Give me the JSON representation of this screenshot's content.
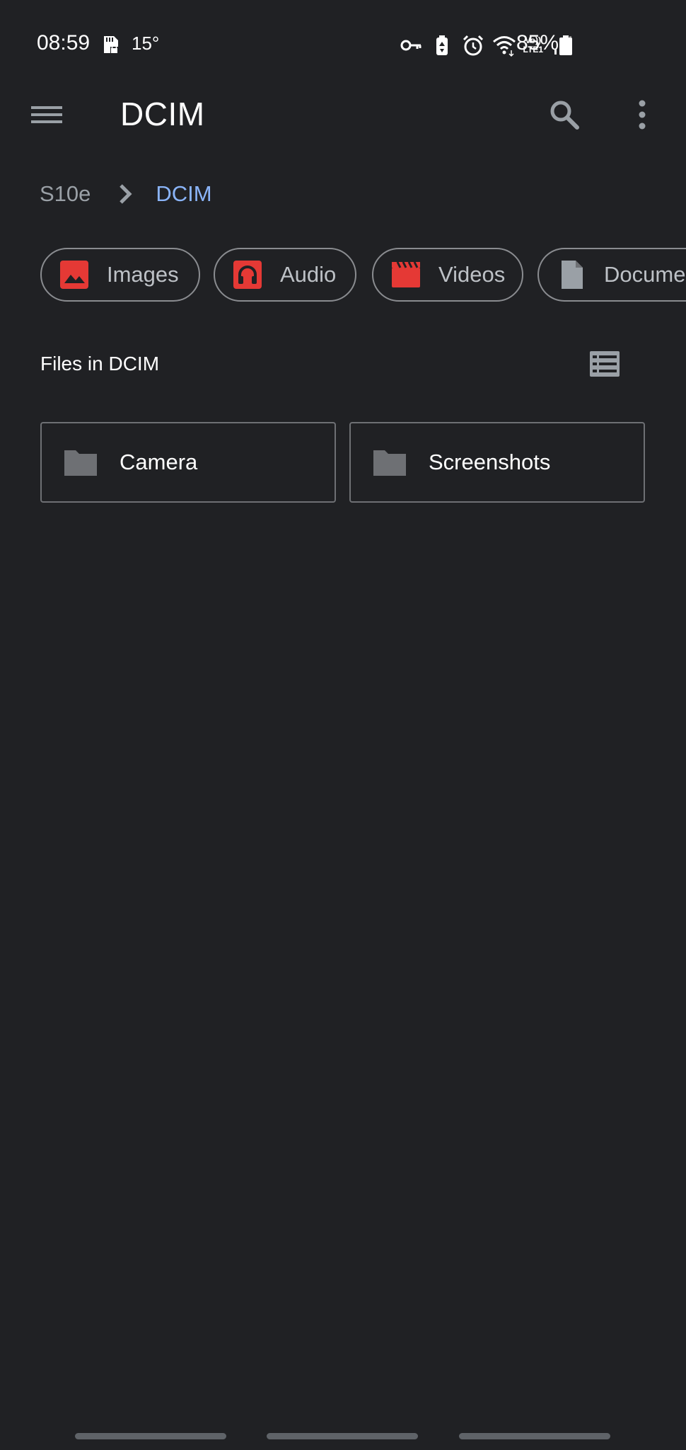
{
  "status_bar": {
    "time": "08:59",
    "temperature": "15°",
    "volte_top": "Vo))",
    "volte_bottom": "LTE1",
    "battery_percent": "85%",
    "icons": [
      "sd-card-lock-icon",
      "vpn-key-icon",
      "battery-saver-icon",
      "alarm-icon",
      "wifi-icon",
      "volte-icon",
      "signal-icon",
      "battery-icon"
    ]
  },
  "app_bar": {
    "title": "DCIM",
    "icons": [
      "menu-icon",
      "search-icon",
      "more-vert-icon"
    ]
  },
  "breadcrumb": {
    "root": "S10e",
    "current": "DCIM"
  },
  "categories": [
    {
      "label": "Images",
      "icon": "image-icon",
      "color": "#e53935"
    },
    {
      "label": "Audio",
      "icon": "headphones-icon",
      "color": "#e53935"
    },
    {
      "label": "Videos",
      "icon": "clapperboard-icon",
      "color": "#e53935"
    },
    {
      "label": "Docume",
      "icon": "document-icon",
      "color": "#9aa0a6"
    }
  ],
  "section": {
    "title": "Files in DCIM",
    "view_icon": "list-view-icon"
  },
  "folders": [
    {
      "name": "Camera",
      "icon": "folder-icon"
    },
    {
      "name": "Screenshots",
      "icon": "folder-icon"
    }
  ],
  "colors": {
    "background": "#202124",
    "accent_blue": "#8ab4f8",
    "category_red": "#e53935",
    "icon_grey": "#9aa0a6"
  }
}
